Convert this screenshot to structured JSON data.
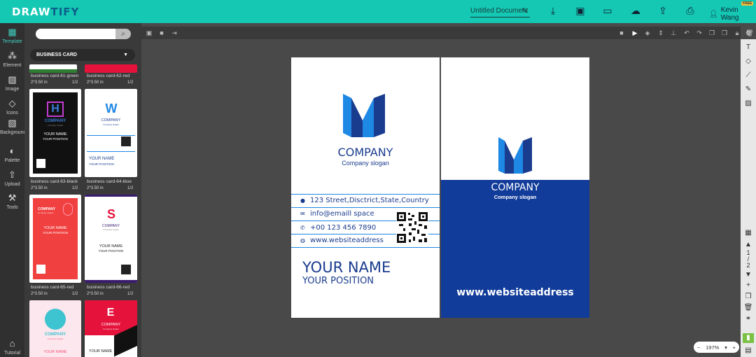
{
  "app": {
    "logo_main": "DRAW",
    "logo_accent": "TIFY",
    "doc_title": "Untitled Document",
    "user_name": "Kevin Wang",
    "free_badge": "FREE"
  },
  "toolbar": [
    {
      "icon": "download-icon",
      "glyph": "⤓",
      "label": "Download"
    },
    {
      "icon": "save-icon",
      "glyph": "🖫",
      "label": "Save"
    },
    {
      "icon": "present-icon",
      "glyph": "🖵",
      "label": "Present"
    },
    {
      "icon": "cloud-icon",
      "glyph": "☁",
      "label": "Cloud"
    },
    {
      "icon": "share-icon",
      "glyph": "⇪",
      "label": "Share"
    },
    {
      "icon": "print-icon",
      "glyph": "⎙",
      "label": "Print"
    }
  ],
  "leftnav": [
    {
      "name": "Template",
      "icon": "template-icon",
      "glyph": "▦",
      "active": true
    },
    {
      "name": "Element",
      "icon": "element-icon",
      "glyph": "⁂",
      "active": false
    },
    {
      "name": "Image",
      "icon": "image-icon",
      "glyph": "▨",
      "active": false
    },
    {
      "name": "Icons",
      "icon": "icons-icon",
      "glyph": "◇",
      "active": false
    },
    {
      "name": "Background",
      "icon": "background-icon",
      "glyph": "▧",
      "active": false
    },
    {
      "name": "Palette",
      "icon": "palette-icon",
      "glyph": "◐",
      "active": false
    },
    {
      "name": "Upload",
      "icon": "upload-icon",
      "glyph": "⇧",
      "active": false
    },
    {
      "name": "Tools",
      "icon": "tools-icon",
      "glyph": "⚒",
      "active": false
    },
    {
      "name": "Tutorial",
      "icon": "tutorial-icon",
      "glyph": "🎓",
      "active": false
    }
  ],
  "panel": {
    "search_placeholder": "",
    "category": "BUSINESS CARD",
    "thumbs": [
      {
        "name": "business card-61-green",
        "size": "2*3.50 in",
        "page": "1/2"
      },
      {
        "name": "business card-62-red",
        "size": "2*3.50 in",
        "page": "1/2"
      },
      {
        "name": "business card-63-black",
        "size": "2*3.50 in",
        "page": "1/2"
      },
      {
        "name": "business card-64-blue",
        "size": "2*3.50 in",
        "page": "1/2"
      },
      {
        "name": "business card-65-red",
        "size": "2*3.50 in",
        "page": "1/2"
      },
      {
        "name": "business card-66-red",
        "size": "2*3.50 in",
        "page": "1/2"
      }
    ],
    "t63": {
      "company": "COMPANY",
      "slogan": "Company slogan",
      "your_name": "YOUR NAME",
      "your_position": "YOUR POSITION"
    },
    "t64": {
      "company": "COMPANY",
      "slogan": "Company slogan",
      "your_name": "YOUR NAME",
      "your_position": "YOUR POSITION"
    },
    "t65": {
      "company": "COMPANY",
      "slogan": "Company slogan",
      "your_name": "YOUR NAME",
      "your_position": "YOUR POSITION"
    },
    "t66": {
      "company": "COMPANY",
      "slogan": "Company slogan",
      "your_name": "YOUR NAME",
      "your_position": "YOUR POSITION"
    },
    "t67": {
      "company": "COMPANY",
      "slogan": "Company slogan",
      "your_name": "YOUR NAME"
    },
    "t68": {
      "company": "COMPANY",
      "slogan": "Company slogan",
      "your_name": "YOUR NAME"
    }
  },
  "front": {
    "company": "COMPANY",
    "slogan": "Company slogan",
    "address": "123 Street,Disctrict,State,Country",
    "email": "info@emaill space",
    "phone": "+00 123 456 7890",
    "website": "www.websiteaddress",
    "your_name": "YOUR NAME",
    "your_position": "YOUR POSITION"
  },
  "back": {
    "company": "COMPANY",
    "slogan": "Company slogan",
    "website": "www.websiteaddress"
  },
  "pager": {
    "current": "1",
    "sep": "/",
    "total": "2"
  },
  "zoom": {
    "minus": "−",
    "value": "197%",
    "caret": "▾",
    "plus": "+"
  },
  "colors": {
    "accent": "#14c8b4",
    "brand_blue": "#1a3c8e",
    "logo_blue": "#1e88e5"
  }
}
